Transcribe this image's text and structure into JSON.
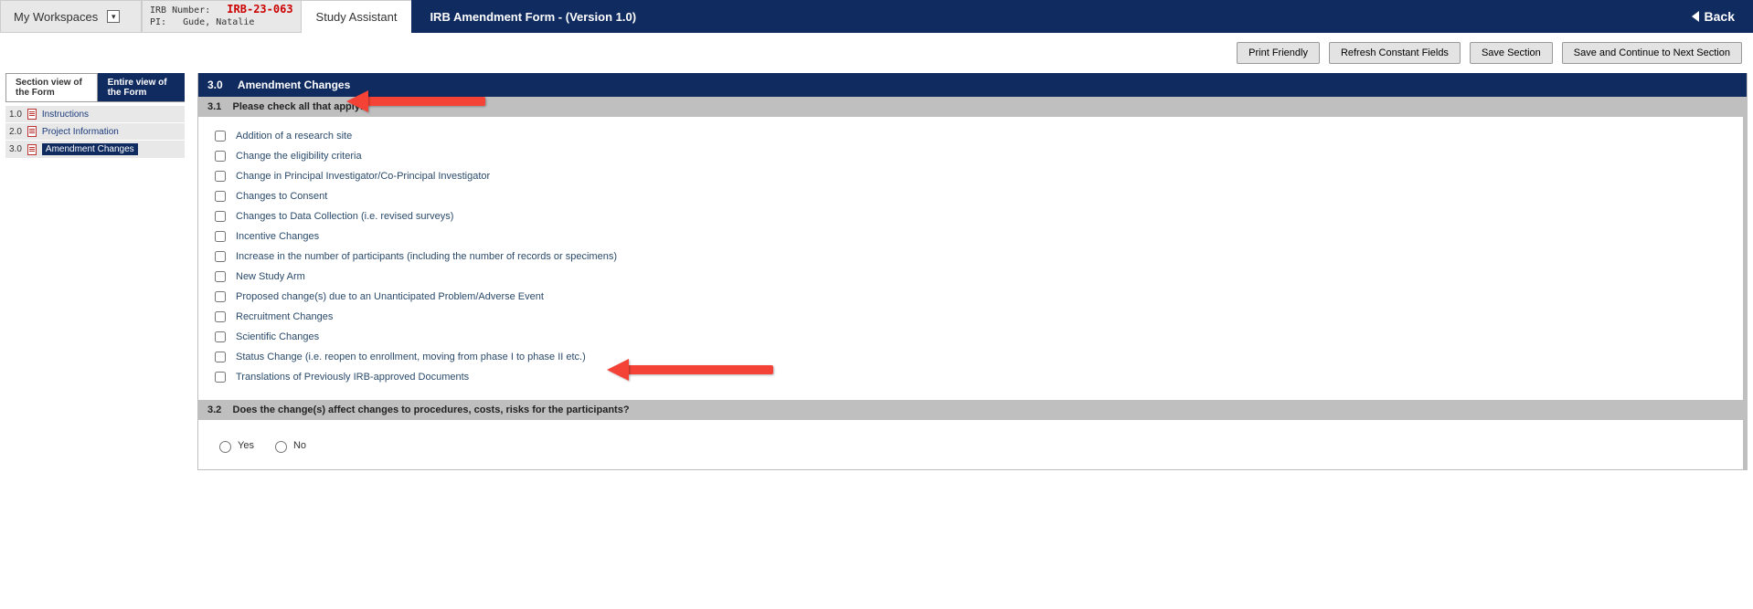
{
  "header": {
    "workspaces_label": "My Workspaces",
    "irb_number_label": "IRB Number:",
    "irb_number_value": "IRB-23-063",
    "pi_label": "PI:",
    "pi_value": "Gude, Natalie",
    "active_tab": "Study Assistant",
    "form_title": "IRB Amendment Form - (Version 1.0)",
    "back_label": "Back"
  },
  "actions": {
    "print": "Print Friendly",
    "refresh": "Refresh Constant Fields",
    "save": "Save Section",
    "save_continue": "Save and Continue to Next Section"
  },
  "view_tabs": {
    "section": "Section view of the Form",
    "entire": "Entire view of the Form"
  },
  "nav": [
    {
      "num": "1.0",
      "label": "Instructions",
      "selected": false
    },
    {
      "num": "2.0",
      "label": "Project Information",
      "selected": false
    },
    {
      "num": "3.0",
      "label": "Amendment Changes",
      "selected": true
    }
  ],
  "section": {
    "num": "3.0",
    "title": "Amendment Changes",
    "q31_num": "3.1",
    "q31_text": "Please check all that apply:",
    "options": [
      "Addition of a research site",
      "Change the eligibility criteria",
      "Change in Principal Investigator/Co-Principal Investigator",
      "Changes to Consent",
      "Changes to Data Collection (i.e. revised surveys)",
      "Incentive Changes",
      "Increase in the number of participants (including the number of records or specimens)",
      "New Study Arm",
      "Proposed change(s) due to an Unanticipated Problem/Adverse Event",
      "Recruitment Changes",
      "Scientific Changes",
      "Status Change (i.e. reopen to enrollment, moving from phase I to phase II etc.)",
      "Translations of Previously IRB-approved Documents"
    ],
    "q32_num": "3.2",
    "q32_text": "Does the change(s) affect changes to procedures, costs, risks for the participants?",
    "yes": "Yes",
    "no": "No"
  }
}
